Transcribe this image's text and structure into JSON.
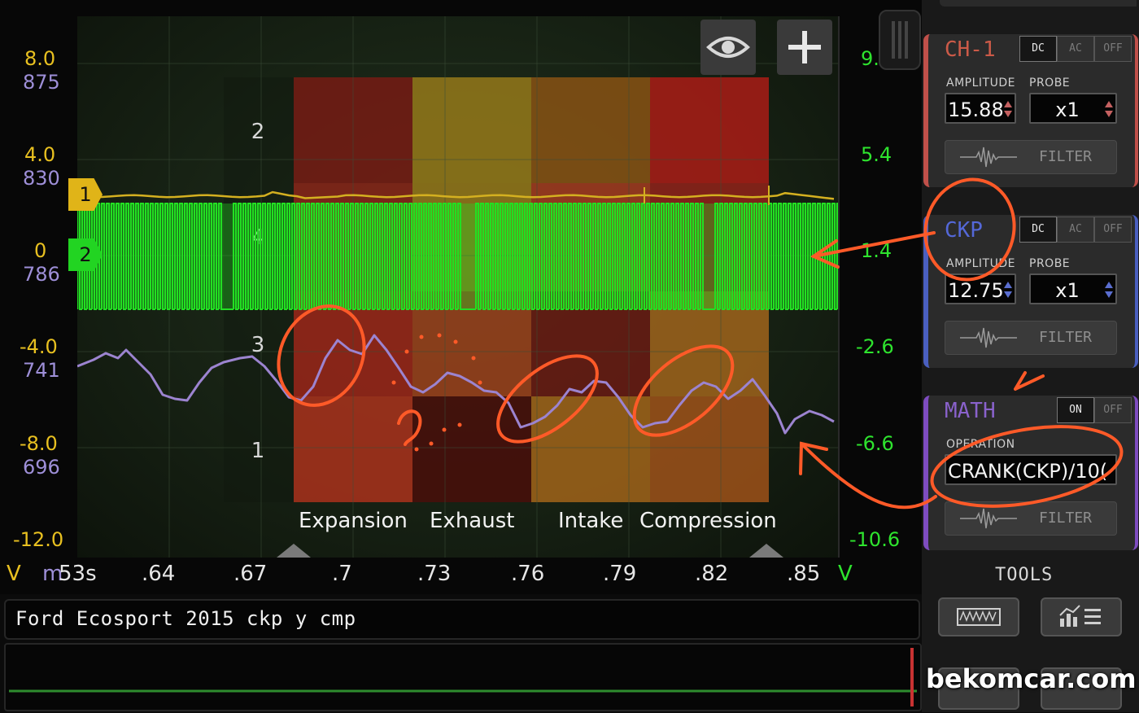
{
  "left_axis": {
    "amplitude_ticks": [
      "8.0",
      "4.0",
      "0",
      "-4.0",
      "-8.0",
      "-12.0"
    ],
    "math_ticks": [
      "875",
      "830",
      "786",
      "741",
      "696"
    ],
    "unit": "V",
    "math_unit": "m"
  },
  "right_axis": {
    "ticks": [
      "9.",
      "5.4",
      "1.4",
      "-2.6",
      "-6.6",
      "-10.6"
    ],
    "unit": "V"
  },
  "x_axis": {
    "first_label": "53s",
    "ticks": [
      ".64",
      ".67",
      ".7",
      ".73",
      ".76",
      ".79",
      ".82",
      ".85"
    ]
  },
  "channel_markers": {
    "ch1": "1",
    "ch2": "2"
  },
  "background_numbers": [
    "2",
    "4",
    "3",
    "1"
  ],
  "strokes": [
    "Expansion",
    "Exhaust",
    "Intake",
    "Compression"
  ],
  "colors": {
    "ch1_trace": "#d4b020",
    "ckp_trace": "#22e022",
    "math_trace": "#9c84d0",
    "annotation": "#ff5a28",
    "ch1_border": "#c0504a",
    "ckp_border": "#4a5fc0",
    "math_border": "#7e4cc0"
  },
  "toolbar": {
    "eye_icon": "eye-icon",
    "add_icon": "plus-icon"
  },
  "capture_title": "Ford Ecosport 2015 ckp y cmp",
  "channels": [
    {
      "name": "CH-1",
      "modes": [
        "DC",
        "AC",
        "OFF"
      ],
      "active_mode": "DC",
      "amplitude_caption": "AMPLITUDE",
      "amplitude_value": "15.88",
      "probe_caption": "PROBE",
      "probe_value": "x1",
      "filter_label": "FILTER"
    },
    {
      "name": "CKP",
      "modes": [
        "DC",
        "AC",
        "OFF"
      ],
      "active_mode": "DC",
      "amplitude_caption": "AMPLITUDE",
      "amplitude_value": "12.75",
      "probe_caption": "PROBE",
      "probe_value": "x1",
      "filter_label": "FILTER"
    }
  ],
  "math": {
    "name": "MATH",
    "modes": [
      "ON",
      "OFF"
    ],
    "active_mode": "ON",
    "operation_caption": "OPERATION",
    "operation_value": "CRANK(CKP)/10(",
    "filter_label": "FILTER"
  },
  "tools": {
    "label": "TOOLS",
    "buttons": [
      "waveform-icon",
      "chart-list-icon"
    ]
  },
  "watermark": "bekomcar.com"
}
